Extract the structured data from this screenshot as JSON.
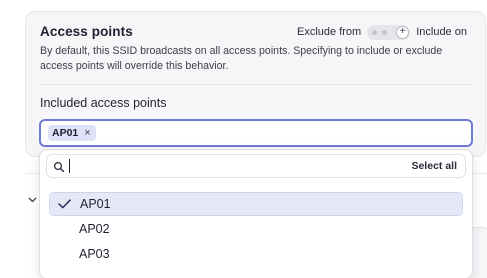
{
  "access_points": {
    "title": "Access points",
    "toggle": {
      "left_label": "Exclude from",
      "right_label": "Include on",
      "knob_symbol": "+",
      "state": "include"
    },
    "description": "By default, this SSID broadcasts on all access points. Specifying to include or exclude access points will override this behavior.",
    "field_label": "Included access points",
    "selected_chips": [
      {
        "label": "AP01",
        "remove_symbol": "×"
      }
    ],
    "dropdown": {
      "search_value": "",
      "select_all_label": "Select all",
      "options": [
        {
          "label": "AP01",
          "selected": true
        },
        {
          "label": "AP02",
          "selected": false
        },
        {
          "label": "AP03",
          "selected": false
        }
      ]
    }
  },
  "colors": {
    "focus_border": "#6e7bd6",
    "chip_bg": "#dfe2f6",
    "selected_option_bg": "#e6e8f8",
    "card_bg": "#f6f6f8"
  },
  "icons": {
    "search": "search-icon",
    "check": "check-icon",
    "remove": "close-icon",
    "collapse": "chevron-down-icon",
    "toggle_plus": "plus-icon"
  }
}
